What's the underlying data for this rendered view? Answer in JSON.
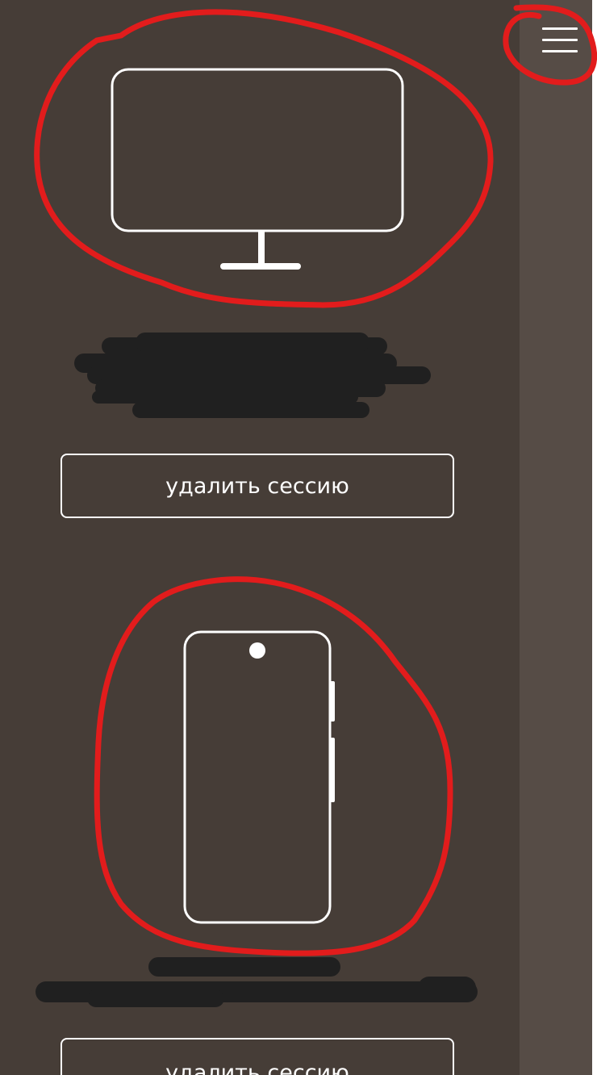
{
  "header": {
    "menu_icon": "hamburger-menu-icon"
  },
  "sessions": [
    {
      "device_icon": "desktop-monitor-icon",
      "info_line_1": "",
      "info_line_2": "",
      "delete_label": "удалить сессию"
    },
    {
      "device_icon": "smartphone-icon",
      "info_line_1": "",
      "info_line_2": "",
      "delete_label": "удалить сессию"
    }
  ],
  "colors": {
    "background": "#463d37",
    "sidebar": "#564c46",
    "foreground": "#ffffff",
    "annotation": "#e21c1c",
    "redaction": "#202020"
  }
}
